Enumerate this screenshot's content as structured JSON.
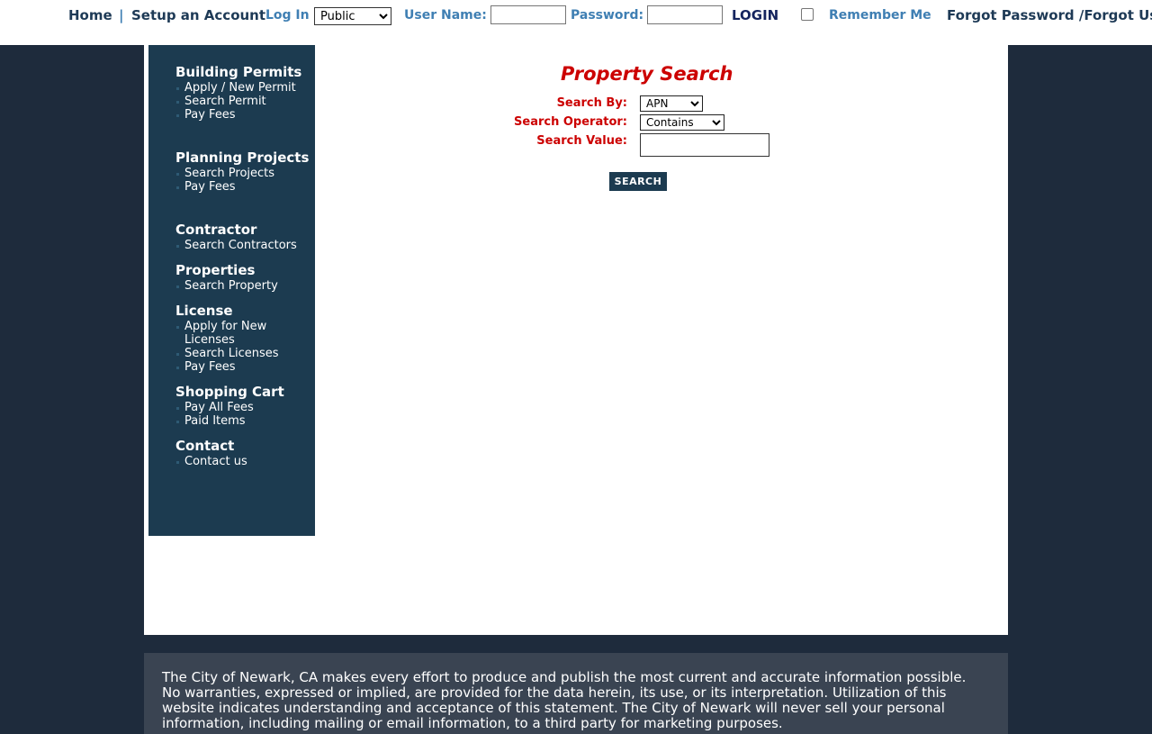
{
  "topbar": {
    "home": "Home",
    "separator": "|",
    "setup_account": "Setup an Account",
    "login_as_label": "Log In",
    "login_as_value": "Public",
    "username_label": "User Name:",
    "password_label": "Password:",
    "login_button": "LOGIN",
    "remember_me": "Remember Me",
    "forgot": "Forgot Password /Forgot Use"
  },
  "sidebar": {
    "sections": [
      {
        "title": "Building Permits",
        "links": [
          "Apply / New Permit",
          "Search Permit",
          "Pay Fees"
        ]
      },
      {
        "title": "Planning Projects",
        "links": [
          "Search Projects",
          "Pay Fees"
        ]
      },
      {
        "title": "Contractor",
        "links": [
          "Search Contractors"
        ]
      },
      {
        "title": "Properties",
        "links": [
          "Search Property"
        ]
      },
      {
        "title": "License",
        "links": [
          "Apply for New Licenses",
          "Search Licenses",
          "Pay Fees"
        ]
      },
      {
        "title": "Shopping Cart",
        "links": [
          "Pay All Fees",
          "Paid Items"
        ]
      },
      {
        "title": "Contact",
        "links": [
          "Contact us"
        ]
      }
    ]
  },
  "search": {
    "title": "Property Search",
    "search_by_label": "Search By:",
    "search_by_value": "APN",
    "operator_label": "Search Operator:",
    "operator_value": "Contains",
    "value_label": "Search Value:",
    "value": "",
    "button": "SEARCH"
  },
  "footer": {
    "disclaimer": "The City of Newark, CA makes every effort to produce and publish the most current and accurate information possible. No warranties, expressed or implied, are provided for the data herein, its use, or its interpretation. Utilization of this website indicates understanding and acceptance of this statement.  The City of Newark will never sell your personal information, including mailing or email information, to a third party for marketing purposes."
  }
}
